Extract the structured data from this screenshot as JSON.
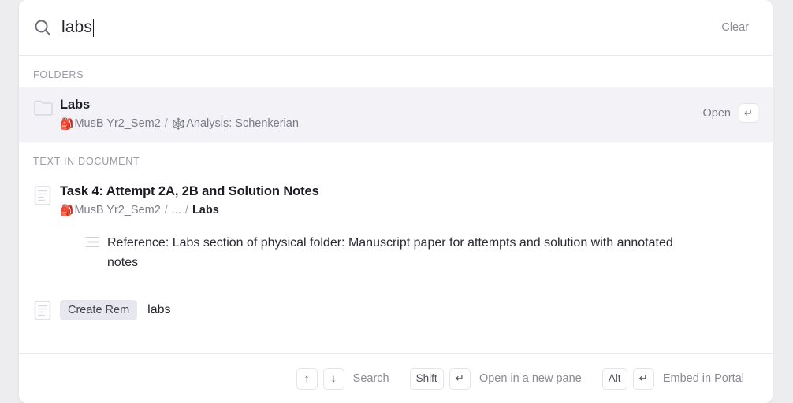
{
  "search": {
    "query": "labs",
    "placeholder": "Search",
    "clear_label": "Clear",
    "icon": "search-icon"
  },
  "sections": {
    "folders": {
      "label": "FOLDERS",
      "result": {
        "icon": "folder-icon",
        "title": "Labs",
        "breadcrumb": {
          "parent_emoji": "🎒",
          "parent": "MusB Yr2_Sem2",
          "separator": "/",
          "child_emoji": "🕸️",
          "child": "Analysis: Schenkerian"
        },
        "action_label": "Open",
        "action_key": "↵"
      }
    },
    "text_in_document": {
      "label": "TEXT IN DOCUMENT",
      "result": {
        "icon": "document-icon",
        "title": "Task 4: Attempt 2A, 2B and Solution Notes",
        "breadcrumb": {
          "parent_emoji": "🎒",
          "parent": "MusB Yr2_Sem2",
          "separator": "/",
          "ellipsis": "...",
          "separator2": "/",
          "child": "Labs"
        },
        "snippet": "Reference: Labs section of physical folder: Manuscript paper for attempts and solution with annotated notes"
      }
    },
    "create": {
      "icon": "document-icon",
      "chip_label": "Create Rem",
      "query": "labs"
    }
  },
  "footer": {
    "hints": [
      {
        "keys": [
          "↑",
          "↓"
        ],
        "label": "Search"
      },
      {
        "keys": [
          "Shift",
          "↵"
        ],
        "label": "Open in a new pane"
      },
      {
        "keys": [
          "Alt",
          "↵"
        ],
        "label": "Embed in Portal"
      }
    ]
  },
  "colors": {
    "panel_bg": "#ffffff",
    "page_bg": "#ededf0",
    "selected_row": "#f2f2f7",
    "muted_text": "#8b8b96",
    "title_text": "#1c1c24",
    "chip_bg": "#e7e7ef"
  }
}
